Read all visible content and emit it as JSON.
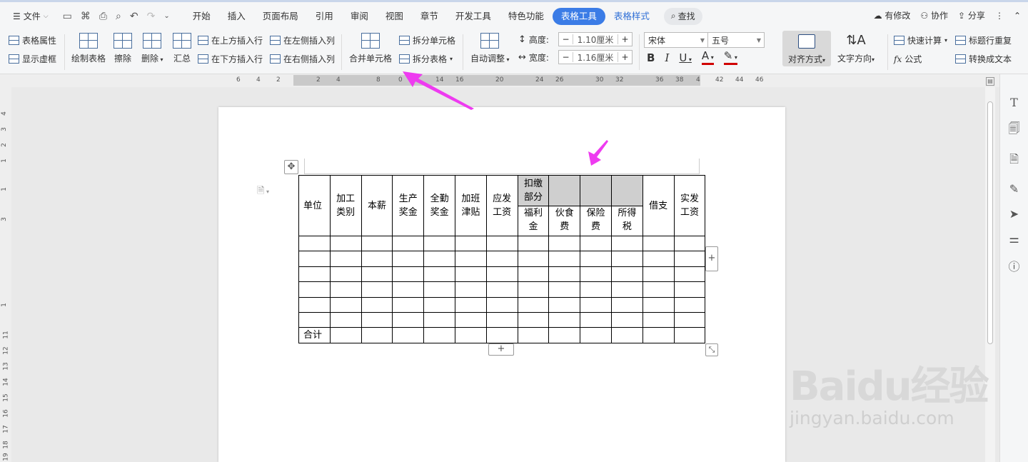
{
  "topbar": {
    "file_menu": "文件",
    "tabs": [
      "开始",
      "插入",
      "页面布局",
      "引用",
      "审阅",
      "视图",
      "章节",
      "开发工具",
      "特色功能"
    ],
    "active_tab": "表格工具",
    "table_style_tab": "表格样式",
    "search": "查找",
    "has_changes": "有修改",
    "collab": "协作",
    "share": "分享"
  },
  "ribbon": {
    "table_props": "表格属性",
    "show_gridlines": "显示虚框",
    "draw_table": "绘制表格",
    "erase": "擦除",
    "delete": "删除",
    "summary": "汇总",
    "insert_above": "在上方插入行",
    "insert_below": "在下方插入行",
    "insert_left": "在左侧插入列",
    "insert_right": "在右侧插入列",
    "merge_cells": "合并单元格",
    "split_cells": "拆分单元格",
    "split_table": "拆分表格",
    "auto_fit": "自动调整",
    "height_label": "高度:",
    "height_value": "1.10厘米",
    "width_label": "宽度:",
    "width_value": "1.16厘米",
    "font_name": "宋体",
    "font_size": "五号",
    "align": "对齐方式",
    "text_dir": "文字方向",
    "quick_calc": "快速计算",
    "repeat_header": "标题行重复",
    "formula": "公式",
    "to_text": "转换成文本"
  },
  "ruler": {
    "top": [
      "6",
      "4",
      "2",
      "2",
      "4",
      "8",
      "0",
      "14",
      "16",
      "20",
      "24",
      "26",
      "30",
      "32",
      "36",
      "38",
      "4",
      "42",
      "44",
      "46"
    ],
    "left": [
      "4",
      "3",
      "2",
      "1",
      "1",
      "3",
      "1",
      "11",
      "12",
      "13",
      "14",
      "15",
      "16",
      "17",
      "18",
      "19"
    ]
  },
  "table": {
    "header": [
      "单位",
      "加工类别",
      "本薪",
      "生产奖金",
      "全勤奖金",
      "加班津贴",
      "应发工资",
      "扣缴部分",
      "",
      "",
      "",
      "借支",
      "实发工资"
    ],
    "subheader": [
      "福利金",
      "伙食费",
      "保险费",
      "所得税"
    ],
    "total": "合计"
  },
  "watermark": {
    "brand": "Baidu经验",
    "url": "jingyan.baidu.com"
  }
}
